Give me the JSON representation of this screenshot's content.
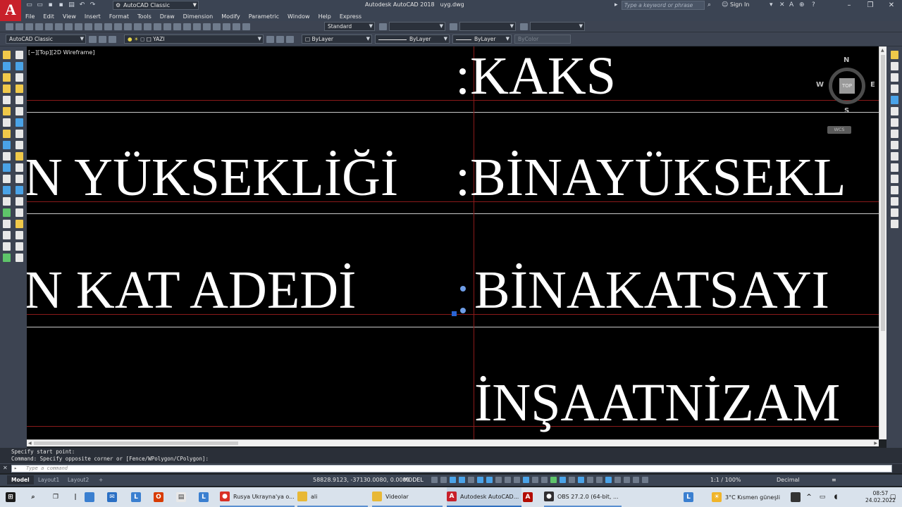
{
  "app": {
    "logo_letter": "A",
    "title": "Autodesk AutoCAD 2018",
    "filename": "uyg.dwg",
    "workspace": "AutoCAD Classic",
    "search_placeholder": "Type a keyword or phrase",
    "sign_in": "Sign In",
    "accent": "#c8202a"
  },
  "menu": [
    "File",
    "Edit",
    "View",
    "Insert",
    "Format",
    "Tools",
    "Draw",
    "Dimension",
    "Modify",
    "Parametric",
    "Window",
    "Help",
    "Express"
  ],
  "toolbar": {
    "text_style": "Standard",
    "workspace2": "AutoCAD Classic",
    "layer": "YAZI",
    "color": "ByLayer",
    "linetype": "ByLayer",
    "lineweight": "ByLayer",
    "plot_style": "ByColor"
  },
  "canvas": {
    "viewport_label": "[−][Top][2D Wireframe]",
    "text_entities": [
      {
        "text": ":KAKS"
      },
      {
        "text": "N YÜKSEKLİĞİ"
      },
      {
        "text": ":BİNAYÜKSEKL"
      },
      {
        "text": "N KAT ADEDİ"
      },
      {
        "text": "BİNAKATSAYI"
      },
      {
        "text": "İNŞAATNİZAM"
      }
    ],
    "viewcube": {
      "top": "TOP",
      "north": "N",
      "south": "S",
      "east": "E",
      "west": "W",
      "wcs": "WCS"
    }
  },
  "command": {
    "history": [
      "Specify start point:",
      "Command: Specify opposite corner or [Fence/WPolygon/CPolygon]:"
    ],
    "placeholder": "Type a command"
  },
  "layout_tabs": [
    {
      "label": "Model",
      "active": true
    },
    {
      "label": "Layout1",
      "active": false
    },
    {
      "label": "Layout2",
      "active": false
    }
  ],
  "status": {
    "coordinates": "58828.9123, -37130.0080, 0.0000",
    "model": "MODEL",
    "scale": "1:1 / 100%",
    "units": "Decimal"
  },
  "taskbar": {
    "items": [
      {
        "label": "Rusya Ukrayna'ya o...",
        "icon": "chrome-icon",
        "color": "#d93025"
      },
      {
        "label": "ali",
        "icon": "folder-icon",
        "color": "#e8b836"
      },
      {
        "label": "Videolar",
        "icon": "folder-icon",
        "color": "#e8b836"
      },
      {
        "label": "Autodesk AutoCAD...",
        "icon": "autocad-icon",
        "color": "#c8202a"
      },
      {
        "label": "OBS 27.2.0 (64-bit, ...",
        "icon": "obs-icon",
        "color": "#302e31"
      }
    ],
    "weather": "3°C  Kısmen güneşli",
    "time": "08:57",
    "date": "24.02.2022"
  }
}
